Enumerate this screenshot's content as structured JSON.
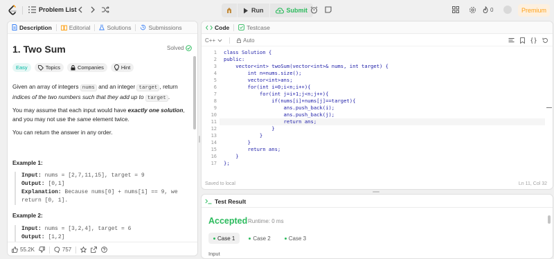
{
  "topbar": {
    "problem_list": "Problem List",
    "run": "Run",
    "submit": "Submit",
    "streak": "0",
    "premium": "Premium"
  },
  "left_tabs": [
    "Description",
    "Editorial",
    "Solutions",
    "Submissions"
  ],
  "problem": {
    "title": "1. Two Sum",
    "status": "Solved",
    "chips": [
      "Easy",
      "Topics",
      "Companies",
      "Hint"
    ],
    "p1_a": "Given an array of integers ",
    "p1_code1": "nums",
    "p1_b": " and an integer ",
    "p1_code2": "target",
    "p1_c": ", return ",
    "p1_em": "indices of the two numbers such that they add up to",
    "p1_code3": "target",
    "p1_d": ".",
    "p2_a": "You may assume that each input would have ",
    "p2_em": "exactly one solution",
    "p2_b": ", and you may not use the ",
    "p2_em2": "same",
    "p2_c": " element twice.",
    "p3": "You can return the answer in any order.",
    "example1_title": "Example 1:",
    "example1": {
      "input_label": "Input:",
      "input": " nums = [2,7,11,15], target = 9",
      "output_label": "Output:",
      "output": " [0,1]",
      "explanation_label": "Explanation:",
      "explanation": " Because nums[0] + nums[1] == 9, we",
      "explanation2": "return [0, 1]."
    },
    "example2_title": "Example 2:",
    "example2": {
      "input_label": "Input:",
      "input": " nums = [3,2,4], target = 6",
      "output_label": "Output:",
      "output": " [1,2]"
    }
  },
  "footer": {
    "likes": "55.2K",
    "comments": "757"
  },
  "code_tabs": [
    "Code",
    "Testcase"
  ],
  "editor": {
    "language": "C++",
    "mode": "Auto",
    "lines": [
      "class Solution {",
      "public:",
      "    vector<int> twoSum(vector<int>& nums, int target) {",
      "        int n=nums.size();",
      "        vector<int>ans;",
      "        for(int i=0;i<n;i++){",
      "            for(int j=i+1;j<n;j++){",
      "                if(nums[i]+nums[j]==target){",
      "                    ans.push_back(i);",
      "                    ans.push_back(j);",
      "                    return ans;",
      "                }",
      "            }",
      "        }",
      "        return ans;",
      "    }",
      "};"
    ],
    "saved": "Saved to local",
    "position": "Ln 11, Col 32"
  },
  "test_result": {
    "tab": "Test Result",
    "status": "Accepted",
    "runtime": "Runtime: 0 ms",
    "cases": [
      "Case 1",
      "Case 2",
      "Case 3"
    ],
    "input_label": "Input"
  },
  "colors": {
    "accent_green": "#2cbb5d",
    "accent_orange": "#ffa116",
    "easy": "#00b8a3"
  }
}
